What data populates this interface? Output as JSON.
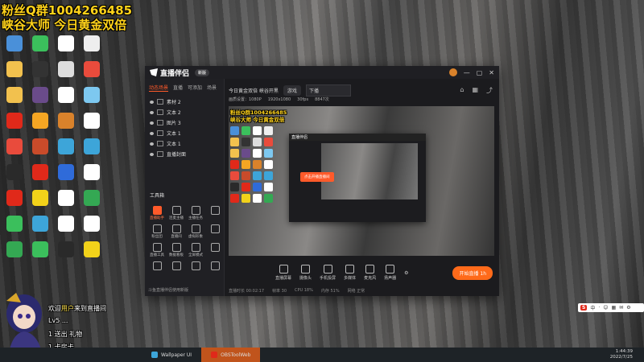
{
  "overlay": {
    "line1": "粉丝Q群1004266485",
    "line2": "峡谷大师 今日黄金双倍"
  },
  "desktop_icons": [
    {
      "name": "icon",
      "color": "#4a90d9"
    },
    {
      "name": "icon",
      "color": "#3bbf5c"
    },
    {
      "name": "icon",
      "color": "#ffffff"
    },
    {
      "name": "icon",
      "color": "#eeeeee"
    },
    {
      "name": "icon",
      "color": "#f2c14e"
    },
    {
      "name": "icon",
      "color": "#333333"
    },
    {
      "name": "icon",
      "color": "#dddddd"
    },
    {
      "name": "icon",
      "color": "#e94b3c"
    },
    {
      "name": "icon",
      "color": "#f2c14e"
    },
    {
      "name": "icon",
      "color": "#6a4b8a"
    },
    {
      "name": "icon",
      "color": "#ffffff"
    },
    {
      "name": "icon",
      "color": "#7dc8f0"
    },
    {
      "name": "icon",
      "color": "#e0291a"
    },
    {
      "name": "icon",
      "color": "#f5a623"
    },
    {
      "name": "icon",
      "color": "#d9822b"
    },
    {
      "name": "icon",
      "color": "#ffffff"
    },
    {
      "name": "icon",
      "color": "#e94b3c"
    },
    {
      "name": "icon",
      "color": "#c94b2a"
    },
    {
      "name": "icon",
      "color": "#3da5d9"
    },
    {
      "name": "icon",
      "color": "#3da5d9"
    },
    {
      "name": "icon",
      "color": "#2a2a2a"
    },
    {
      "name": "icon",
      "color": "#e0291a"
    },
    {
      "name": "icon",
      "color": "#2f6bd9"
    },
    {
      "name": "icon",
      "color": "#ffffff"
    },
    {
      "name": "icon",
      "color": "#e0291a"
    },
    {
      "name": "icon",
      "color": "#f2d21a"
    },
    {
      "name": "icon",
      "color": "#ffffff"
    },
    {
      "name": "icon",
      "color": "#34a853"
    },
    {
      "name": "icon",
      "color": "#3bbf5c"
    },
    {
      "name": "icon",
      "color": "#3da5d9"
    },
    {
      "name": "icon",
      "color": "#ffffff"
    },
    {
      "name": "icon",
      "color": "#ffffff"
    },
    {
      "name": "icon",
      "color": "#34a853"
    },
    {
      "name": "icon",
      "color": "#3bbf5c"
    },
    {
      "name": "icon",
      "color": "#2a2a2a"
    },
    {
      "name": "icon",
      "color": "#f2d21a"
    }
  ],
  "app": {
    "title": "直播伴侣",
    "version": "新版",
    "tabs": [
      "动态场景",
      "直播",
      "可添加",
      "场景"
    ],
    "scenes": [
      "素材 2",
      "文本 2",
      "图片 3",
      "文本 1",
      "文本 1",
      "直播封面"
    ],
    "toolbox_title": "工具箱",
    "tools": [
      {
        "label": "直播助手",
        "hot": true
      },
      {
        "label": "连麦主播",
        "hot": false
      },
      {
        "label": "主播任务",
        "hot": false
      },
      {
        "label": "",
        "hot": false
      },
      {
        "label": "粉丝团",
        "hot": false
      },
      {
        "label": "直播间",
        "hot": false
      },
      {
        "label": "虚拟形象",
        "hot": false
      },
      {
        "label": "",
        "hot": false
      },
      {
        "label": "直播工具",
        "hot": false
      },
      {
        "label": "数据看板",
        "hot": false
      },
      {
        "label": "全屏模式",
        "hot": false
      },
      {
        "label": "",
        "hot": false
      },
      {
        "label": "",
        "hot": false
      },
      {
        "label": "",
        "hot": false
      },
      {
        "label": "",
        "hot": false
      },
      {
        "label": "",
        "hot": false
      }
    ],
    "notice": "斗鱼直播伴侣使用新版",
    "topbar": {
      "title": "今日黄金双倍 峡谷开黑",
      "category": "游戏",
      "input": "下播"
    },
    "substats": [
      "画质设置：1080P",
      "1920x1080",
      "30fps",
      "8847次"
    ],
    "preview": {
      "line1": "粉丝Q群1004266485",
      "line2": "峡谷大师 今日黄金双倍",
      "inner_title": "直播伴侣",
      "inner_btn": "点击开播直播间"
    },
    "bottom_buttons": [
      "直播屏幕",
      "摄像头",
      "手机投屏",
      "多媒体",
      "麦克风",
      "扬声器"
    ],
    "live_button": "开始直播 1h",
    "status": [
      "直播时长 00:02:17",
      "帧率 30",
      "CPU 18%",
      "内存 51%",
      "网络 正常"
    ]
  },
  "chat": [
    {
      "prefix": "欢迎",
      "name": "用户",
      "text": "来到直播间"
    },
    {
      "prefix": "",
      "name": "",
      "text": "Lv5 ..."
    },
    {
      "prefix": "1 ",
      "name": "",
      "text": "送出 礼物"
    },
    {
      "prefix": "1 ",
      "name": "",
      "text": "卡房卡"
    }
  ],
  "ime": {
    "s": "S",
    "items": [
      "中",
      "·",
      "☺",
      "▦",
      "✉",
      "⚙"
    ]
  },
  "taskbar": {
    "tasks": [
      {
        "label": "Wallpaper UI",
        "color": "#3da5d9",
        "active": false
      },
      {
        "label": "OBSToolWeb",
        "color": "#e0291a",
        "active": true
      }
    ],
    "time": "1:44:39",
    "date": "2022/7/25"
  }
}
